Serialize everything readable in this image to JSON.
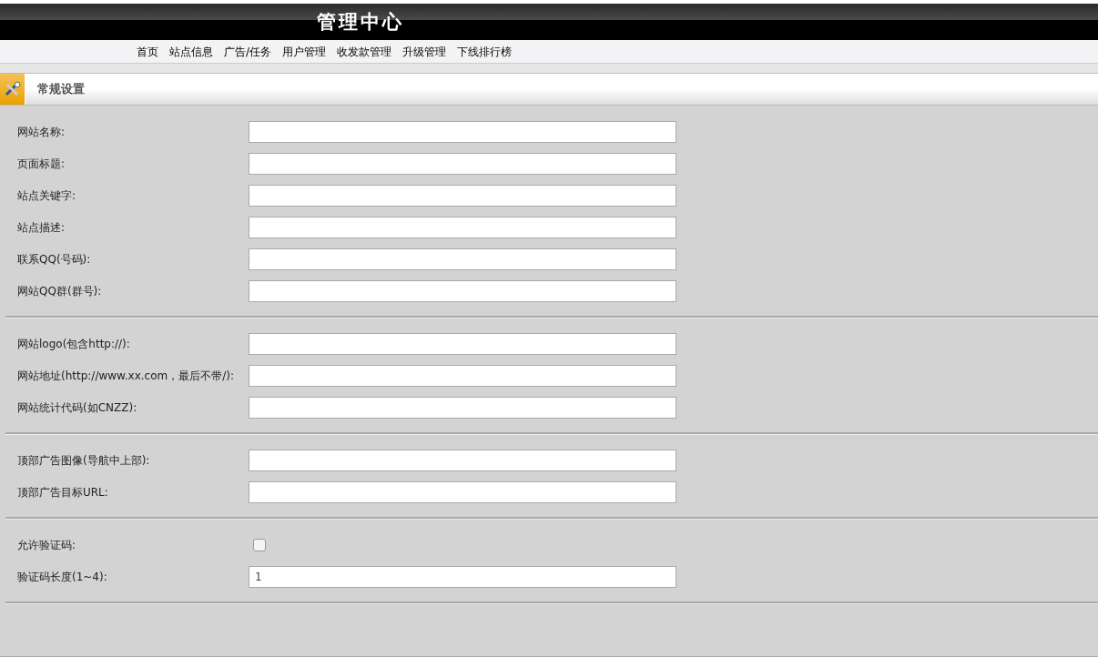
{
  "header": {
    "title": "管理中心"
  },
  "nav": {
    "items": [
      {
        "label": "首页"
      },
      {
        "label": "站点信息"
      },
      {
        "label": "广告/任务"
      },
      {
        "label": "用户管理"
      },
      {
        "label": "收发款管理"
      },
      {
        "label": "升级管理"
      },
      {
        "label": "下线排行榜"
      }
    ]
  },
  "section": {
    "title": "常规设置"
  },
  "groups": [
    {
      "fields": [
        {
          "kind": "text",
          "label": "网站名称:"
        },
        {
          "kind": "text",
          "label": "页面标题:"
        },
        {
          "kind": "text",
          "label": "站点关键字:"
        },
        {
          "kind": "text",
          "label": "站点描述:"
        },
        {
          "kind": "text",
          "label": "联系QQ(号码):"
        },
        {
          "kind": "text",
          "label": "网站QQ群(群号):"
        }
      ]
    },
    {
      "fields": [
        {
          "kind": "text",
          "label": "网站logo(包含http://):"
        },
        {
          "kind": "text",
          "label": "网站地址(http://www.xx.com，最后不带/):"
        },
        {
          "kind": "text",
          "label": "网站统计代码(如CNZZ):"
        }
      ]
    },
    {
      "fields": [
        {
          "kind": "text",
          "label": "顶部广告图像(导航中上部):"
        },
        {
          "kind": "text",
          "label": "顶部广告目标URL:"
        }
      ]
    },
    {
      "fields": [
        {
          "kind": "checkbox",
          "label": "允许验证码:",
          "checked": false
        },
        {
          "kind": "text",
          "label": "验证码长度(1~4):",
          "value": "1"
        }
      ]
    }
  ]
}
